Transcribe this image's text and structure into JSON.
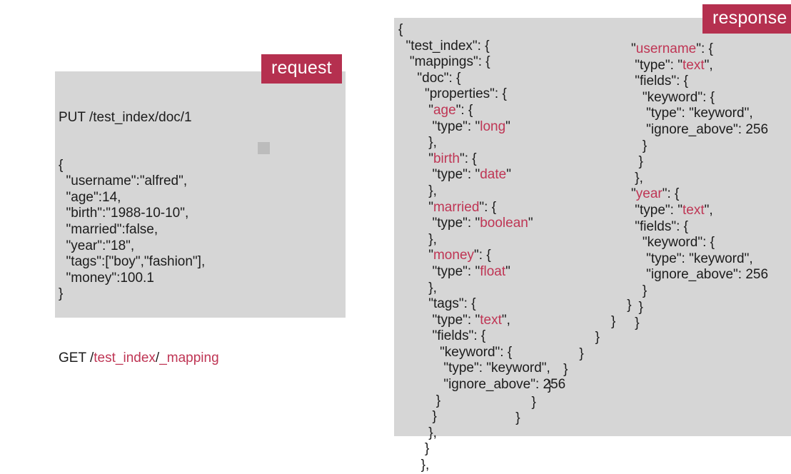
{
  "badges": {
    "request": "request",
    "response": "response"
  },
  "colors": {
    "panel_background": "#d6d6d6",
    "page_background": "#ffffff",
    "badge_background": "#b5304f",
    "badge_text": "#ffffff",
    "code_text": "#1c1c1c",
    "highlight_red": "#bf3554",
    "artifact_square": "#bcbcbc"
  },
  "request": {
    "method_line": {
      "method": "PUT",
      "path_plain": " /test_index/doc/1"
    },
    "body_lines": [
      "{",
      "  \"username\":\"alfred\",",
      "  \"age\":14,",
      "  \"birth\":\"1988-10-10\",",
      "  \"married\":false,",
      "  \"year\":\"18\",",
      "  \"tags\":[\"boy\",\"fashion\"],",
      "  \"money\":100.1",
      "}",
      ""
    ],
    "get_line": {
      "method": "GET",
      "slash1": " /",
      "index": "test_index",
      "slash2": "/",
      "endpoint": "_mapping"
    }
  },
  "response": {
    "left_column": [
      [
        {
          "t": "{",
          "c": "k"
        }
      ],
      [
        {
          "t": "  \"test_index\": {",
          "c": "k"
        }
      ],
      [
        {
          "t": "   \"mappings\": {",
          "c": "k"
        }
      ],
      [
        {
          "t": "     \"doc\": {",
          "c": "k"
        }
      ],
      [
        {
          "t": "       \"properties\": {",
          "c": "k"
        }
      ],
      [
        {
          "t": "        \"",
          "c": "k"
        },
        {
          "t": "age",
          "c": "r"
        },
        {
          "t": "\": {",
          "c": "k"
        }
      ],
      [
        {
          "t": "         \"type\": \"",
          "c": "k"
        },
        {
          "t": "long",
          "c": "r"
        },
        {
          "t": "\"",
          "c": "k"
        }
      ],
      [
        {
          "t": "        },",
          "c": "k"
        }
      ],
      [
        {
          "t": "        \"",
          "c": "k"
        },
        {
          "t": "birth",
          "c": "r"
        },
        {
          "t": "\": {",
          "c": "k"
        }
      ],
      [
        {
          "t": "         \"type\": \"",
          "c": "k"
        },
        {
          "t": "date",
          "c": "r"
        },
        {
          "t": "\"",
          "c": "k"
        }
      ],
      [
        {
          "t": "        },",
          "c": "k"
        }
      ],
      [
        {
          "t": "        \"",
          "c": "k"
        },
        {
          "t": "married",
          "c": "r"
        },
        {
          "t": "\": {",
          "c": "k"
        }
      ],
      [
        {
          "t": "         \"type\": \"",
          "c": "k"
        },
        {
          "t": "boolean",
          "c": "r"
        },
        {
          "t": "\"",
          "c": "k"
        }
      ],
      [
        {
          "t": "        },",
          "c": "k"
        }
      ],
      [
        {
          "t": "        \"",
          "c": "k"
        },
        {
          "t": "money",
          "c": "r"
        },
        {
          "t": "\": {",
          "c": "k"
        }
      ],
      [
        {
          "t": "         \"type\": \"",
          "c": "k"
        },
        {
          "t": "float",
          "c": "r"
        },
        {
          "t": "\"",
          "c": "k"
        }
      ],
      [
        {
          "t": "        },",
          "c": "k"
        }
      ],
      [
        {
          "t": "        \"tags\": {",
          "c": "k"
        }
      ],
      [
        {
          "t": "         \"type\": \"",
          "c": "k"
        },
        {
          "t": "text",
          "c": "r"
        },
        {
          "t": "\",",
          "c": "k"
        }
      ],
      [
        {
          "t": "         \"fields\": {",
          "c": "k"
        }
      ],
      [
        {
          "t": "           \"keyword\": {",
          "c": "k"
        }
      ],
      [
        {
          "t": "            \"type\": \"keyword\",",
          "c": "k"
        }
      ],
      [
        {
          "t": "            \"ignore_above\": 256",
          "c": "k"
        }
      ],
      [
        {
          "t": "          }",
          "c": "k"
        }
      ],
      [
        {
          "t": "         }",
          "c": "k"
        }
      ],
      [
        {
          "t": "        },",
          "c": "k"
        }
      ]
    ],
    "right_column": [
      [
        {
          "t": "\"",
          "c": "k"
        },
        {
          "t": "username",
          "c": "r"
        },
        {
          "t": "\": {",
          "c": "k"
        }
      ],
      [
        {
          "t": " \"type\": \"",
          "c": "k"
        },
        {
          "t": "text",
          "c": "r"
        },
        {
          "t": "\",",
          "c": "k"
        }
      ],
      [
        {
          "t": " \"fields\": {",
          "c": "k"
        }
      ],
      [
        {
          "t": "   \"keyword\": {",
          "c": "k"
        }
      ],
      [
        {
          "t": "    \"type\": \"keyword\",",
          "c": "k"
        }
      ],
      [
        {
          "t": "    \"ignore_above\": 256",
          "c": "k"
        }
      ],
      [
        {
          "t": "   }",
          "c": "k"
        }
      ],
      [
        {
          "t": "  }",
          "c": "k"
        }
      ],
      [
        {
          "t": " },",
          "c": "k"
        }
      ],
      [
        {
          "t": "\"",
          "c": "k"
        },
        {
          "t": "year",
          "c": "r"
        },
        {
          "t": "\": {",
          "c": "k"
        }
      ],
      [
        {
          "t": " \"type\": \"",
          "c": "k"
        },
        {
          "t": "text",
          "c": "r"
        },
        {
          "t": "\",",
          "c": "k"
        }
      ],
      [
        {
          "t": " \"fields\": {",
          "c": "k"
        }
      ],
      [
        {
          "t": "   \"keyword\": {",
          "c": "k"
        }
      ],
      [
        {
          "t": "    \"type\": \"keyword\",",
          "c": "k"
        }
      ],
      [
        {
          "t": "    \"ignore_above\": 256",
          "c": "k"
        }
      ],
      [
        {
          "t": "   }",
          "c": "k"
        }
      ],
      [
        {
          "t": "  }",
          "c": "k"
        }
      ],
      [
        {
          "t": " }",
          "c": "k"
        }
      ]
    ],
    "closing_braces": [
      "        }",
      "       }",
      "      }",
      "     }",
      "    }",
      "   }",
      "  }",
      " }"
    ],
    "left_column_tail": [
      "       }",
      "      },"
    ]
  }
}
